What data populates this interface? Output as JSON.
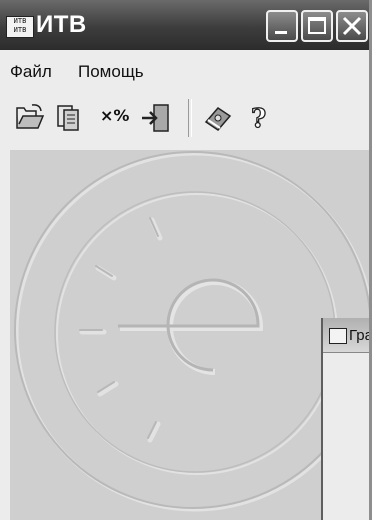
{
  "window": {
    "title": "ИТВ",
    "icon": "app-icon-itv"
  },
  "menu": {
    "file": "Файл",
    "help": "Помощь"
  },
  "toolbar": {
    "buttons": [
      {
        "name": "open-folder-icon"
      },
      {
        "name": "documents-icon"
      },
      {
        "name": "multiply-percent-icon",
        "label": "×%"
      },
      {
        "name": "exit-door-icon"
      },
      {
        "name": "book-icon"
      },
      {
        "name": "help-icon"
      }
    ]
  },
  "child_window": {
    "title": "Граф"
  },
  "colors": {
    "titlebar": "#3d3d3d",
    "client_background": "#cfcfcf",
    "window_background": "#ececec"
  }
}
